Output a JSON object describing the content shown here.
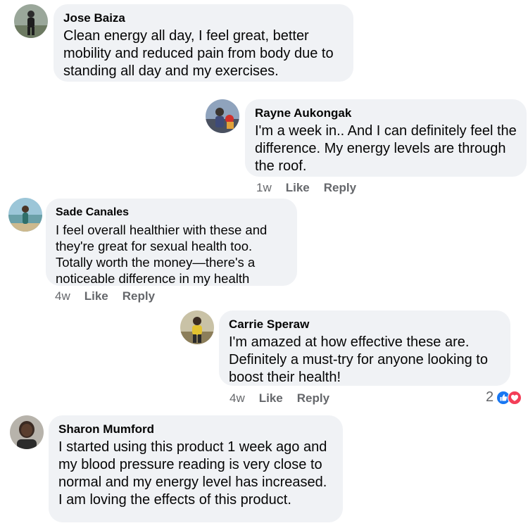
{
  "comments": [
    {
      "author": "Jose Baiza",
      "text": "Clean energy all day, I feel great, better mobility and reduced pain from body due to standing all day and my exercises."
    },
    {
      "author": "Rayne Aukongak",
      "text": "I'm a week in.. And I can definitely feel the difference. My energy levels are through the roof.",
      "time": "1w",
      "like": "Like",
      "reply": "Reply"
    },
    {
      "author": "Sade Canales",
      "text": "I feel overall healthier with these and they're great for sexual health too. Totally worth the money—there's a noticeable difference in my health",
      "time": "4w",
      "like": "Like",
      "reply": "Reply"
    },
    {
      "author": "Carrie Speraw",
      "text": "I'm amazed at how effective these are. Definitely a must-try for anyone looking to boost their health!",
      "time": "4w",
      "like": "Like",
      "reply": "Reply",
      "reaction_count": "2",
      "reaction_icons": [
        "like-icon",
        "love-icon"
      ]
    },
    {
      "author": "Sharon Mumford",
      "text": "I started using this product 1 week ago and my blood pressure reading is very close to normal and my energy level has increased. I am loving the effects of this product."
    }
  ],
  "colors": {
    "bubble": "#f0f2f5",
    "meta_text": "#65676b",
    "like_blue": "#1877f2",
    "love_red": "#f33e58"
  }
}
